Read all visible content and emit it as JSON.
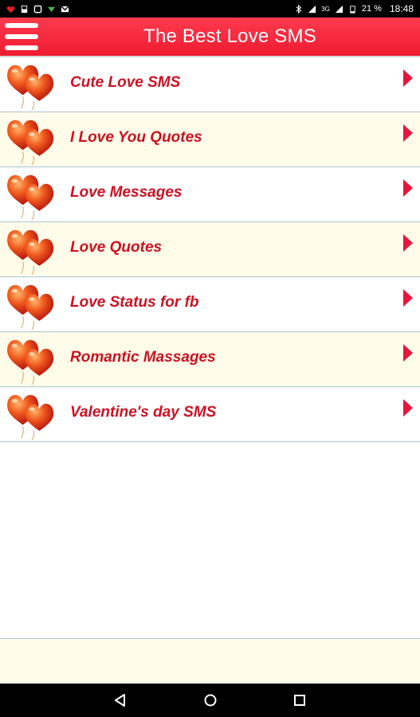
{
  "status_bar": {
    "network": "3G",
    "battery_percent": "21 %",
    "time": "18:48"
  },
  "app_bar": {
    "title": "The Best Love SMS",
    "menu_icon": "hamburger-menu-icon"
  },
  "colors": {
    "app_bar": "#ee1b31",
    "label_text": "#cc1122",
    "row_alt_bg": "#fffde9",
    "divider": "#a8c4d6"
  },
  "list": {
    "item_icon": "heart-balloons-icon",
    "arrow_icon": "chevron-right-icon",
    "items": [
      {
        "label": "Cute Love SMS"
      },
      {
        "label": "I Love You Quotes"
      },
      {
        "label": "Love Messages"
      },
      {
        "label": "Love Quotes"
      },
      {
        "label": "Love Status for fb"
      },
      {
        "label": "Romantic Massages"
      },
      {
        "label": "Valentine's day SMS"
      }
    ]
  },
  "nav_bar": {
    "back_icon": "back-triangle-icon",
    "home_icon": "home-circle-icon",
    "recents_icon": "recents-square-icon"
  }
}
